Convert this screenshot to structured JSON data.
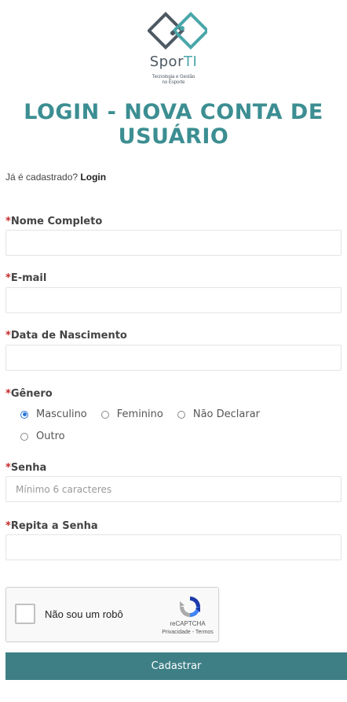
{
  "logo": {
    "brand_prefix": "Spor",
    "brand_suffix": "TI",
    "tagline_line1": "Tecnologia e Gestão",
    "tagline_line2": "no Esporte"
  },
  "page_title": "LOGIN - NOVA CONTA DE USUÁRIO",
  "already_registered": {
    "text": "Já é cadastrado?",
    "link": "Login"
  },
  "fields": {
    "full_name": {
      "required_mark": "*",
      "label": "Nome Completo",
      "value": ""
    },
    "email": {
      "required_mark": "*",
      "label": "E-mail",
      "value": ""
    },
    "birth_date": {
      "required_mark": "*",
      "label": "Data de Nascimento",
      "value": ""
    },
    "gender": {
      "required_mark": "*",
      "label": "Gênero",
      "options": [
        "Masculino",
        "Feminino",
        "Não Declarar",
        "Outro"
      ],
      "selected": "Masculino"
    },
    "password": {
      "required_mark": "*",
      "label": "Senha",
      "placeholder": "Mínimo 6 caracteres",
      "value": ""
    },
    "password_repeat": {
      "required_mark": "*",
      "label": "Repita a Senha",
      "value": ""
    }
  },
  "captcha": {
    "label": "Não sou um robô",
    "brand": "reCAPTCHA",
    "links": "Privacidade - Termos"
  },
  "submit_label": "Cadastrar",
  "colors": {
    "accent": "#3c8e92",
    "button": "#3e7f86",
    "required": "#c62828",
    "radio_checked": "#2a74d6"
  }
}
